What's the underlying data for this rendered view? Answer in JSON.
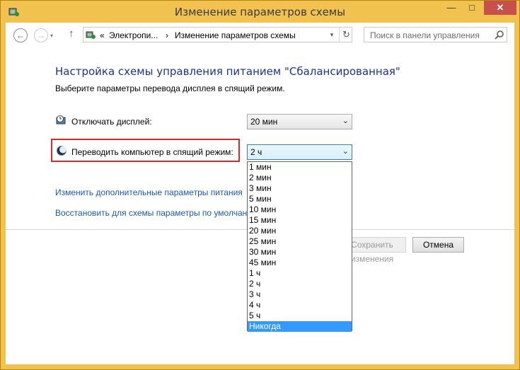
{
  "window": {
    "title": "Изменение параметров схемы",
    "controls": {
      "minimize": "—",
      "maximize": "□",
      "close": "✕"
    }
  },
  "nav": {
    "back_icon": "arrow-left-icon",
    "forward_icon": "arrow-right-icon",
    "up_icon": "arrow-up-icon",
    "up_glyph": "↑",
    "back_glyph": "←",
    "forward_glyph": "→",
    "caret_glyph": "▾"
  },
  "address": {
    "prefix": "«",
    "crumb1": "Электропи...",
    "sep": "›",
    "crumb2": "Изменение параметров схемы",
    "dropdown_glyph": "▾",
    "refresh_glyph": "↻"
  },
  "search": {
    "placeholder": "Поиск в панели управления"
  },
  "main": {
    "heading": "Настройка схемы управления питанием \"Сбалансированная\"",
    "subheading": "Выберите параметры перевода дисплея в спящий режим.",
    "display_off": {
      "label": "Отключать дисплей:",
      "value": "20 мин"
    },
    "sleep": {
      "label": "Переводить компьютер в спящий режим:",
      "value": "2 ч"
    },
    "link_advanced": "Изменить дополнительные параметры питания",
    "link_restore": "Восстановить для схемы параметры по умолчанию",
    "save_label": "Сохранить изменения",
    "cancel_label": "Отмена",
    "combo_arrow": "⌄"
  },
  "dropdown": {
    "options": [
      "1 мин",
      "2 мин",
      "3 мин",
      "5 мин",
      "10 мин",
      "15 мин",
      "20 мин",
      "25 мин",
      "30 мин",
      "45 мин",
      "1 ч",
      "2 ч",
      "3 ч",
      "4 ч",
      "5 ч",
      "Никогда"
    ],
    "selected_index": 15
  },
  "colors": {
    "frame": "#f1c24f",
    "heading": "#1e3287",
    "link": "#1c56b5",
    "highlight_border": "#d12d2d",
    "selection": "#3399ff"
  }
}
